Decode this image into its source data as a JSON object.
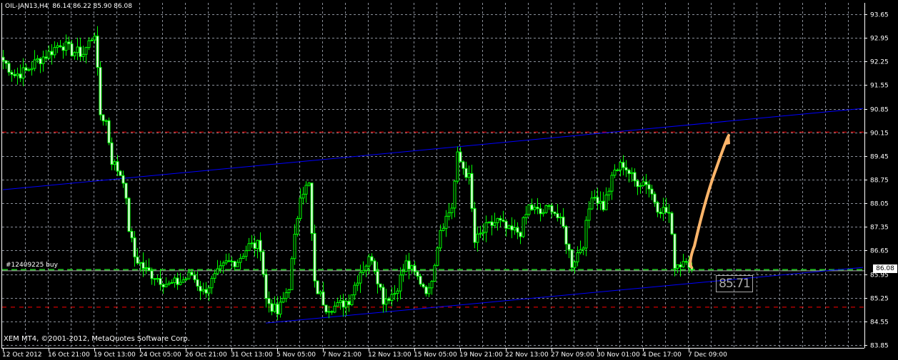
{
  "header": {
    "symbol": "OIL-JAN13,H4",
    "ohlc": "86.14 86.22 85.90 86.08"
  },
  "footer": {
    "copyright": "XEM MT4, ©2001-2012, MetaQuotes Software Corp."
  },
  "order_label": "#12409225 buy",
  "current_price": "86.08",
  "cursor_price": "85.71",
  "colors": {
    "background": "#000000",
    "candle": "#00ff00",
    "grid": "#8a8f99",
    "trendline": "#0000ff",
    "stop_levels": "#ff0000",
    "order_line": "#22b822",
    "arrow": "#ffb56a"
  },
  "chart_data": {
    "type": "candlestick",
    "title": "OIL-JAN13,H4",
    "ylim": [
      83.85,
      93.65
    ],
    "yticks": [
      "93.65",
      "92.95",
      "92.25",
      "91.55",
      "90.85",
      "90.15",
      "89.45",
      "88.75",
      "88.05",
      "87.35",
      "86.65",
      "85.95",
      "85.25",
      "84.55",
      "83.85"
    ],
    "xticks": [
      {
        "bar": 0,
        "label": "12 Oct 2012"
      },
      {
        "bar": 16,
        "label": "16 Oct 21:00"
      },
      {
        "bar": 32,
        "label": "19 Oct 13:00"
      },
      {
        "bar": 48,
        "label": "24 Oct 05:00"
      },
      {
        "bar": 64,
        "label": "26 Oct 21:00"
      },
      {
        "bar": 80,
        "label": "31 Oct 13:00"
      },
      {
        "bar": 96,
        "label": "5 Nov 05:00"
      },
      {
        "bar": 112,
        "label": "7 Nov 21:00"
      },
      {
        "bar": 128,
        "label": "12 Nov 13:00"
      },
      {
        "bar": 144,
        "label": "15 Nov 05:00"
      },
      {
        "bar": 160,
        "label": "19 Nov 21:00"
      },
      {
        "bar": 176,
        "label": "22 Nov 13:00"
      },
      {
        "bar": 192,
        "label": "27 Nov 09:00"
      },
      {
        "bar": 208,
        "label": "30 Nov 01:00"
      },
      {
        "bar": 224,
        "label": "4 Dec 17:00"
      },
      {
        "bar": 240,
        "label": "7 Dec 09:00"
      }
    ],
    "close_path": [
      [
        0,
        92.28
      ],
      [
        4,
        91.85
      ],
      [
        8,
        91.96
      ],
      [
        12,
        92.28
      ],
      [
        16,
        92.49
      ],
      [
        20,
        92.8
      ],
      [
        24,
        92.55
      ],
      [
        28,
        92.49
      ],
      [
        32,
        93.12
      ],
      [
        34,
        90.69
      ],
      [
        36,
        90.48
      ],
      [
        38,
        89.32
      ],
      [
        42,
        88.79
      ],
      [
        44,
        87.31
      ],
      [
        46,
        86.47
      ],
      [
        50,
        86.05
      ],
      [
        54,
        85.84
      ],
      [
        58,
        85.62
      ],
      [
        62,
        85.73
      ],
      [
        66,
        85.94
      ],
      [
        70,
        85.41
      ],
      [
        74,
        85.84
      ],
      [
        78,
        86.26
      ],
      [
        82,
        86.36
      ],
      [
        86,
        86.79
      ],
      [
        90,
        86.79
      ],
      [
        92,
        85.2
      ],
      [
        96,
        84.78
      ],
      [
        100,
        85.62
      ],
      [
        104,
        88.37
      ],
      [
        107,
        88.58
      ],
      [
        109,
        85.62
      ],
      [
        113,
        84.99
      ],
      [
        117,
        84.99
      ],
      [
        121,
        85.2
      ],
      [
        125,
        86.05
      ],
      [
        129,
        86.47
      ],
      [
        133,
        85.2
      ],
      [
        137,
        85.41
      ],
      [
        141,
        86.26
      ],
      [
        145,
        85.84
      ],
      [
        149,
        85.41
      ],
      [
        153,
        87.31
      ],
      [
        157,
        87.95
      ],
      [
        159,
        89.43
      ],
      [
        163,
        88.79
      ],
      [
        165,
        86.89
      ],
      [
        169,
        87.31
      ],
      [
        173,
        87.53
      ],
      [
        177,
        87.21
      ],
      [
        181,
        87.21
      ],
      [
        184,
        87.95
      ],
      [
        188,
        87.74
      ],
      [
        192,
        87.95
      ],
      [
        196,
        87.31
      ],
      [
        199,
        86.26
      ],
      [
        203,
        86.89
      ],
      [
        206,
        88.37
      ],
      [
        210,
        87.95
      ],
      [
        214,
        89.0
      ],
      [
        217,
        89.22
      ],
      [
        221,
        88.69
      ],
      [
        225,
        88.69
      ],
      [
        229,
        87.95
      ],
      [
        233,
        87.74
      ],
      [
        235,
        86.26
      ],
      [
        237,
        86.26
      ],
      [
        239,
        86.47
      ],
      [
        241,
        86.08
      ]
    ],
    "trendlines": [
      {
        "from": [
          0,
          88.45
        ],
        "to": [
          301,
          90.86
        ]
      },
      {
        "from": [
          92,
          84.5
        ],
        "to": [
          301,
          86.15
        ]
      }
    ],
    "order_level": 86.08,
    "take_profit": 90.16,
    "stop_loss": 84.97
  }
}
